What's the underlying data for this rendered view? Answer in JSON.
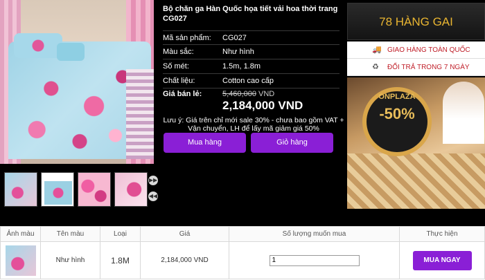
{
  "product": {
    "title": "Bộ chăn ga Hàn Quốc họa tiết vải hoa thời trang CG027",
    "fields": [
      {
        "label": "Mã sản phẩm:",
        "value": "CG027"
      },
      {
        "label": "Màu sắc:",
        "value": "Như hình"
      },
      {
        "label": "Số mét:",
        "value": "1.5m, 1.8m"
      },
      {
        "label": "Chất liệu:",
        "value": "Cotton cao cấp"
      }
    ],
    "price_label": "Giá bán lẻ:",
    "old_price": "5,460,000",
    "old_price_unit": "VND",
    "new_price": "2,184,000 VND",
    "note": "Lưu ý: Giá trên chỉ mới sale 30% - chưa bao gồm VAT + Vận chuyển, LH để lấy mã giảm giá 50%",
    "buy_label": "Mua hàng",
    "cart_label": "Giỏ hàng"
  },
  "sidebar": {
    "banner": "78 HÀNG GAI",
    "services": [
      {
        "icon": "truck-icon",
        "label": "GIAO HÀNG TOÀN QUỐC"
      },
      {
        "icon": "return-icon",
        "label": "ĐỔI TRẢ TRONG 7 NGÀY"
      }
    ],
    "promo_brand": "ONPLAZA",
    "promo_discount": "-50%"
  },
  "table": {
    "headers": [
      "Ảnh màu",
      "Tên màu",
      "Loại",
      "Giá",
      "Số lượng muốn mua",
      "Thực hiện"
    ],
    "row": {
      "color_name": "Như hình",
      "type": "1.8M",
      "price": "2,184,000 VND",
      "quantity": "1",
      "action": "MUA NGAY"
    }
  }
}
